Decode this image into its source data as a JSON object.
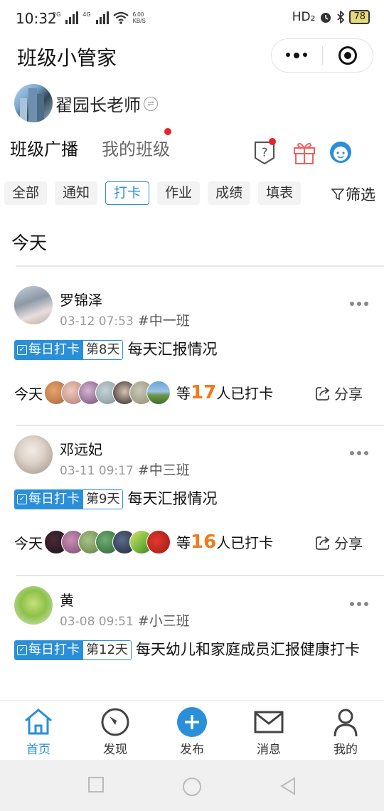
{
  "status": {
    "time": "10:32",
    "sim1": "2G",
    "sim2": "4G",
    "net_speed_value": "6.00",
    "net_speed_unit": "KB/S",
    "hd": "HD₂",
    "battery": "78"
  },
  "header": {
    "title": "班级小管家"
  },
  "user": {
    "name": "翟园长老师"
  },
  "tabs": [
    {
      "label": "班级广播",
      "active": true
    },
    {
      "label": "我的班级",
      "active": false
    }
  ],
  "chips": [
    {
      "label": "全部",
      "active": false
    },
    {
      "label": "通知",
      "active": false
    },
    {
      "label": "打卡",
      "active": true
    },
    {
      "label": "作业",
      "active": false
    },
    {
      "label": "成绩",
      "active": false
    },
    {
      "label": "填表",
      "active": false
    }
  ],
  "filter_label": "筛选",
  "section_title": "今天",
  "posts": [
    {
      "name": "罗锦泽",
      "time": "03-12 07:53",
      "class": "#中一班",
      "badge": "每日打卡",
      "day": "第8天",
      "title": "每天汇报情况",
      "today_label": "今天",
      "count_prefix": "等",
      "count": "17",
      "count_suffix": "人已打卡",
      "share": "分享"
    },
    {
      "name": "邓远妃",
      "time": "03-11 09:17",
      "class": "#中三班",
      "badge": "每日打卡",
      "day": "第9天",
      "title": "每天汇报情况",
      "today_label": "今天",
      "count_prefix": "等",
      "count": "16",
      "count_suffix": "人已打卡",
      "share": "分享"
    },
    {
      "name": "黄",
      "time": "03-08 09:51",
      "class": "#小三班",
      "badge": "每日打卡",
      "day": "第12天",
      "title": "每天幼儿和家庭成员汇报健康打卡"
    }
  ],
  "nav": [
    {
      "label": "首页",
      "icon": "home-icon",
      "active": true
    },
    {
      "label": "发现",
      "icon": "compass-icon",
      "active": false
    },
    {
      "label": "发布",
      "icon": "plus-circle-icon",
      "active": false
    },
    {
      "label": "消息",
      "icon": "mail-icon",
      "active": false
    },
    {
      "label": "我的",
      "icon": "person-icon",
      "active": false
    }
  ],
  "colors": {
    "accent": "#2a8fd9",
    "count": "#f27a1a",
    "dot": "#e8212b"
  }
}
